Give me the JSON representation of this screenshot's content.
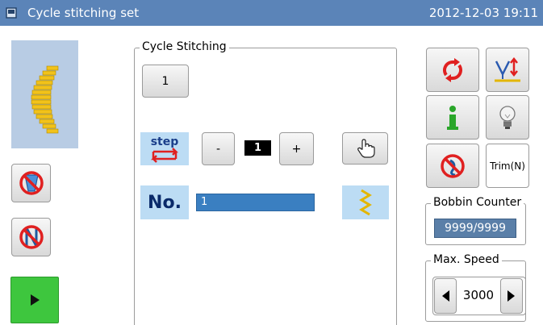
{
  "window": {
    "title": "Cycle stitching set",
    "datetime": "2012-12-03  19:11"
  },
  "cycle": {
    "legend": "Cycle Stitching",
    "pattern_number": "1",
    "step_icon_text": "step",
    "minus_label": "-",
    "plus_label": "+",
    "step_value": "1",
    "no_label": "No.",
    "no_value": "1"
  },
  "right_panel": {
    "trim_label": "Trim(N)",
    "bobbin_legend": "Bobbin Counter",
    "bobbin_value": "9999/9999",
    "speed_legend": "Max. Speed",
    "speed_value": "3000"
  },
  "colors": {
    "title_bar": "#5b84b8",
    "play_button": "#3ec63e",
    "accent_red": "#e02020",
    "accent_green": "#2aa62a",
    "field_blue": "#3a7fc1"
  },
  "icons": [
    "app-icon",
    "pattern-preview",
    "no-bobbin-icon",
    "no-needle-icon",
    "play-icon",
    "step-icon",
    "hand-pointer-icon",
    "no-icon",
    "zigzag-icon",
    "cycle-arrows-icon",
    "needle-position-icon",
    "info-icon",
    "light-bulb-icon",
    "no-thread-wiper-icon",
    "arrow-left-icon",
    "arrow-right-icon"
  ]
}
